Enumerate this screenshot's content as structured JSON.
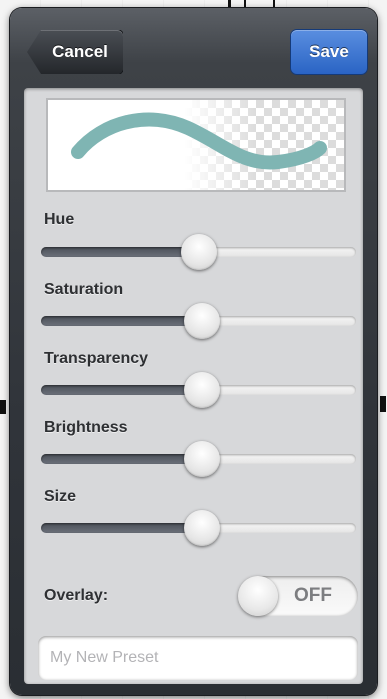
{
  "header": {
    "cancel_label": "Cancel",
    "save_label": "Save"
  },
  "brush_preview": {
    "stroke_color": "#7fb5b3"
  },
  "sliders": [
    {
      "id": "hue",
      "label": "Hue",
      "value": 0.5
    },
    {
      "id": "saturation",
      "label": "Saturation",
      "value": 0.51
    },
    {
      "id": "transparency",
      "label": "Transparency",
      "value": 0.51
    },
    {
      "id": "brightness",
      "label": "Brightness",
      "value": 0.51
    },
    {
      "id": "size",
      "label": "Size",
      "value": 0.51
    }
  ],
  "overlay": {
    "label": "Overlay:",
    "state": "OFF"
  },
  "preset_name": {
    "placeholder": "My New Preset"
  },
  "colors": {
    "save_button": "#2a64c4",
    "panel": "#d7d8da"
  }
}
